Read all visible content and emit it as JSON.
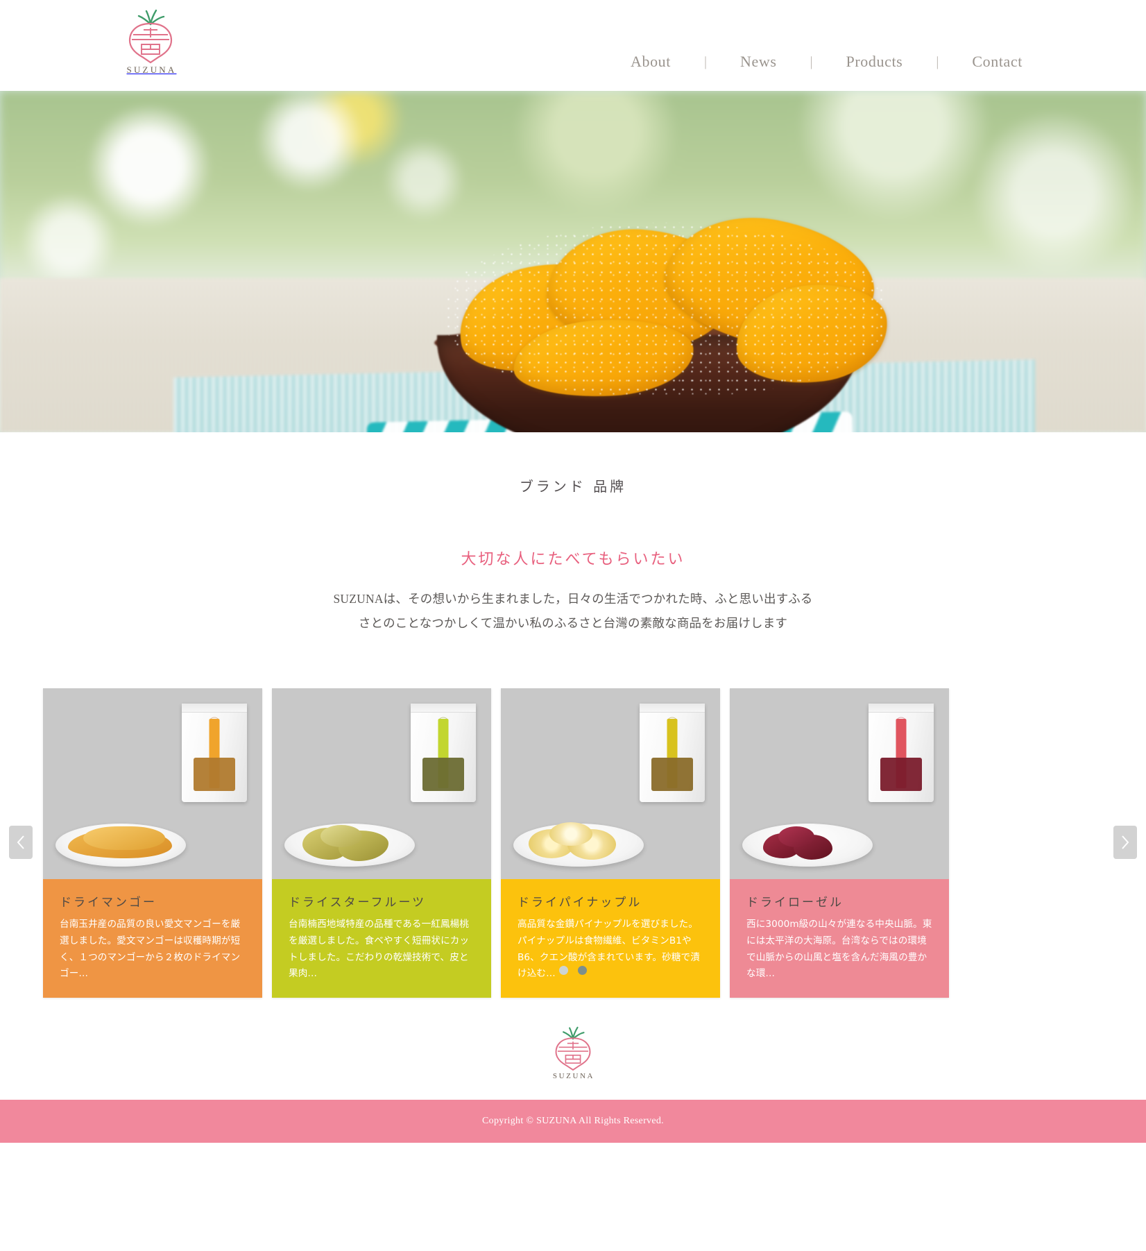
{
  "brandColors": {
    "pink": "#e8607e",
    "footerPink": "#f1889c",
    "logoPink": "#e0728a",
    "leafGreen": "#3f9c6a",
    "navGray": "#9a948e"
  },
  "header": {
    "logo_wordmark": "SUZUNA",
    "logo_icon": "turnip-logo-icon",
    "nav": [
      {
        "label": "About"
      },
      {
        "label": "News"
      },
      {
        "label": "Products"
      },
      {
        "label": "Contact"
      }
    ],
    "nav_separator": "|"
  },
  "hero": {
    "alt": "dried mango pieces in a dark wooden bowl on a teal striped towel"
  },
  "brand": {
    "kicker": "ブランド 品牌",
    "tagline": "大切な人にたべてもらいたい",
    "body": "SUZUNAは、その想いから生まれました，日々の生活でつかれた時、ふと思い出すふるさとのことなつかしくて温かい私のふるさと台灣の素敵な商品をお届けします"
  },
  "carousel": {
    "prev_label": "‹",
    "next_label": "›",
    "dots": [
      {
        "active": false
      },
      {
        "active": true
      }
    ],
    "products": [
      {
        "title": "ドライマンゴー",
        "desc": "台南玉井産の品質の良い愛文マンゴーを厳選しました。愛文マンゴーは収穫時期が短く、１つのマンゴーから２枚のドライマンゴー…",
        "color": "#ef9544",
        "label_color": "#f0a42c",
        "food_color": "#e6a83a",
        "window_color": "#b07a2e"
      },
      {
        "title": "ドライスターフルーツ",
        "desc": "台南楠西地域特産の品種である一紅鳳楊桃を厳選しました。食べやすく短冊状にカットしました。こだわりの乾燥技術で、皮と果肉…",
        "color": "#c4cc22",
        "label_color": "#c2d62f",
        "food_color": "#c0ba58",
        "window_color": "#6c6b33"
      },
      {
        "title": "ドライパイナップル",
        "desc": "高品質な金鑽パイナップルを選びました。パイナップルは食物繊維、ビタミンB1やB6、クエン酸が含まれています。砂糖で漬け込む…",
        "color": "#fcc20d",
        "label_color": "#d8c21e",
        "food_color": "#f0d98a",
        "window_color": "#8a6b2a"
      },
      {
        "title": "ドライローゼル",
        "desc": "西に3000m級の山々が連なる中央山脈。東には太平洋の大海原。台湾ならではの環境で山脈からの山風と塩を含んだ海風の豊かな環…",
        "color": "#ee8a95",
        "label_color": "#e0555f",
        "food_color": "#8c2236",
        "window_color": "#7a1c2c"
      }
    ]
  },
  "footer": {
    "logo_wordmark": "SUZUNA",
    "logo_icon": "turnip-logo-icon",
    "copyright": "Copyright © SUZUNA All Rights Reserved."
  }
}
